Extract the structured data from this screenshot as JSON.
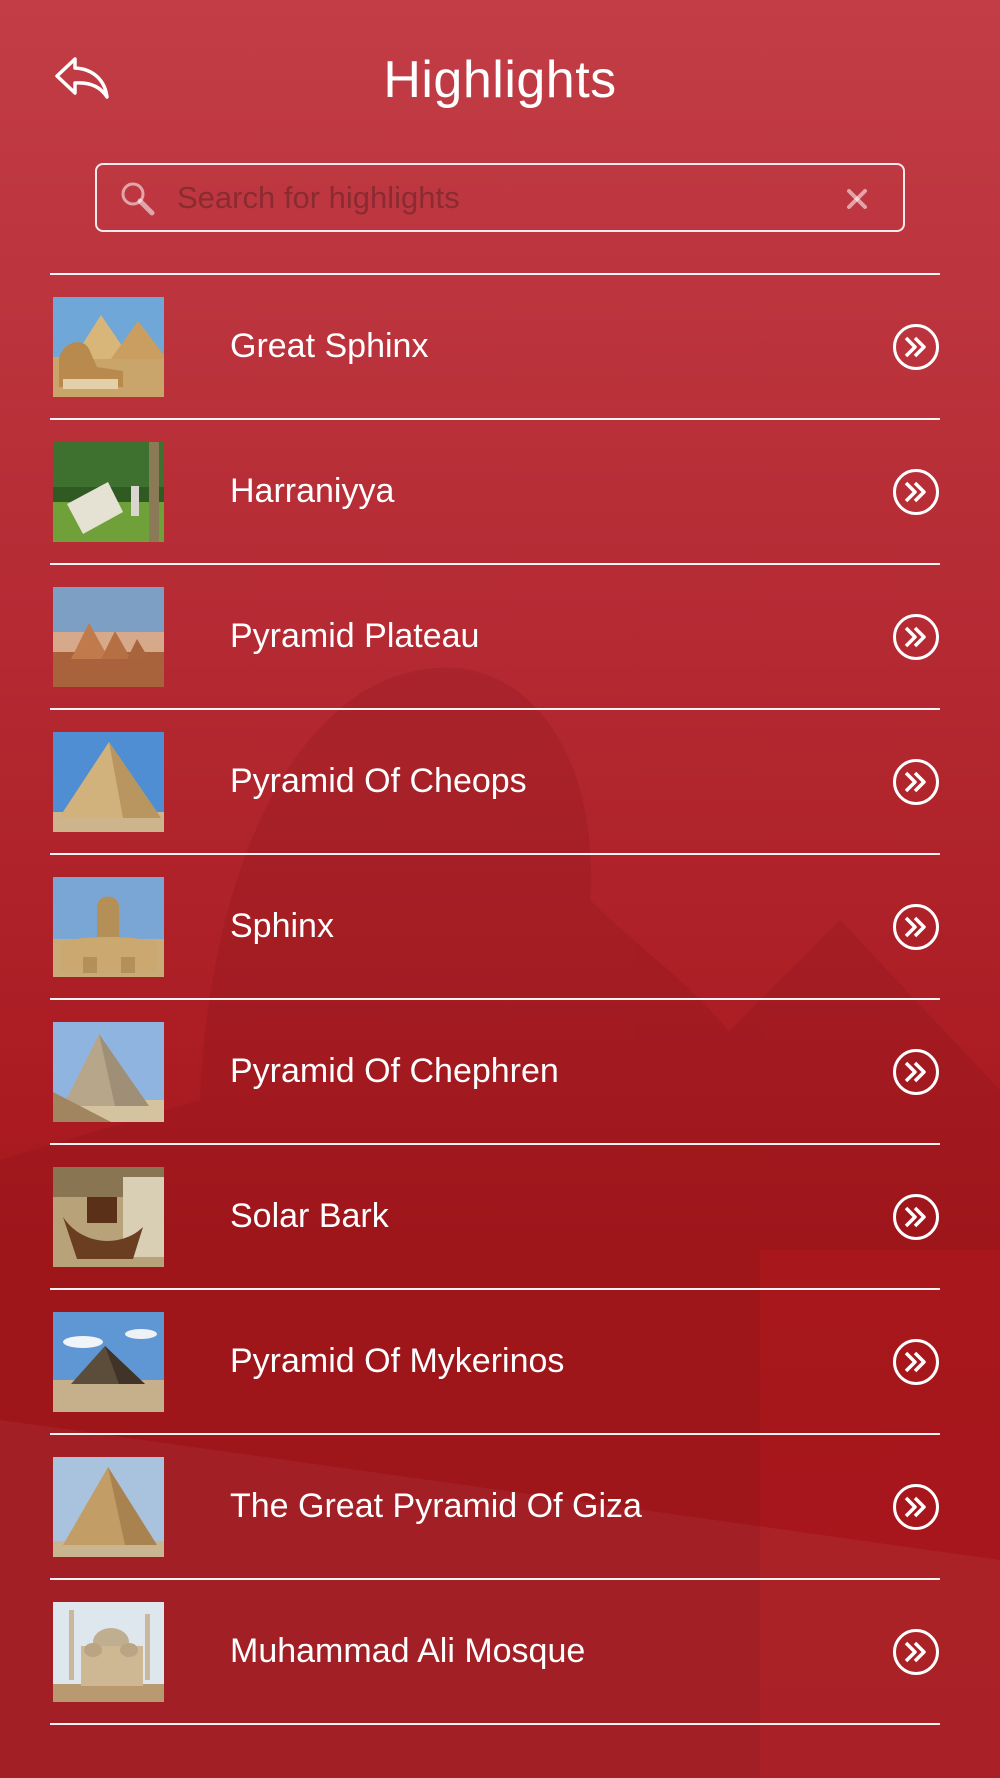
{
  "header": {
    "title": "Highlights",
    "back_icon": "back-arrow-icon"
  },
  "search": {
    "placeholder": "Search for highlights",
    "value": "",
    "icon": "search-icon",
    "clear_icon": "close-icon"
  },
  "highlights": [
    {
      "label": "Great Sphinx",
      "thumb": "sphinx-pyramids-photo"
    },
    {
      "label": "Harraniyya",
      "thumb": "garden-sculpture-photo"
    },
    {
      "label": "Pyramid Plateau",
      "thumb": "pyramids-sunset-photo"
    },
    {
      "label": "Pyramid Of Cheops",
      "thumb": "pyramid-blue-sky-photo"
    },
    {
      "label": "Sphinx",
      "thumb": "sphinx-front-photo"
    },
    {
      "label": "Pyramid Of Chephren",
      "thumb": "pyramid-steps-photo"
    },
    {
      "label": "Solar Bark",
      "thumb": "solar-boat-museum-photo"
    },
    {
      "label": "Pyramid Of Mykerinos",
      "thumb": "pyramid-clouds-photo"
    },
    {
      "label": "The Great Pyramid Of Giza",
      "thumb": "great-pyramid-photo"
    },
    {
      "label": "Muhammad Ali Mosque",
      "thumb": "mosque-photo"
    }
  ],
  "row_action_icon": "double-chevron-right-circle-icon",
  "colors": {
    "background_top": "#c23d46",
    "background_bottom": "#a5161b",
    "foreground": "#ffffff"
  }
}
